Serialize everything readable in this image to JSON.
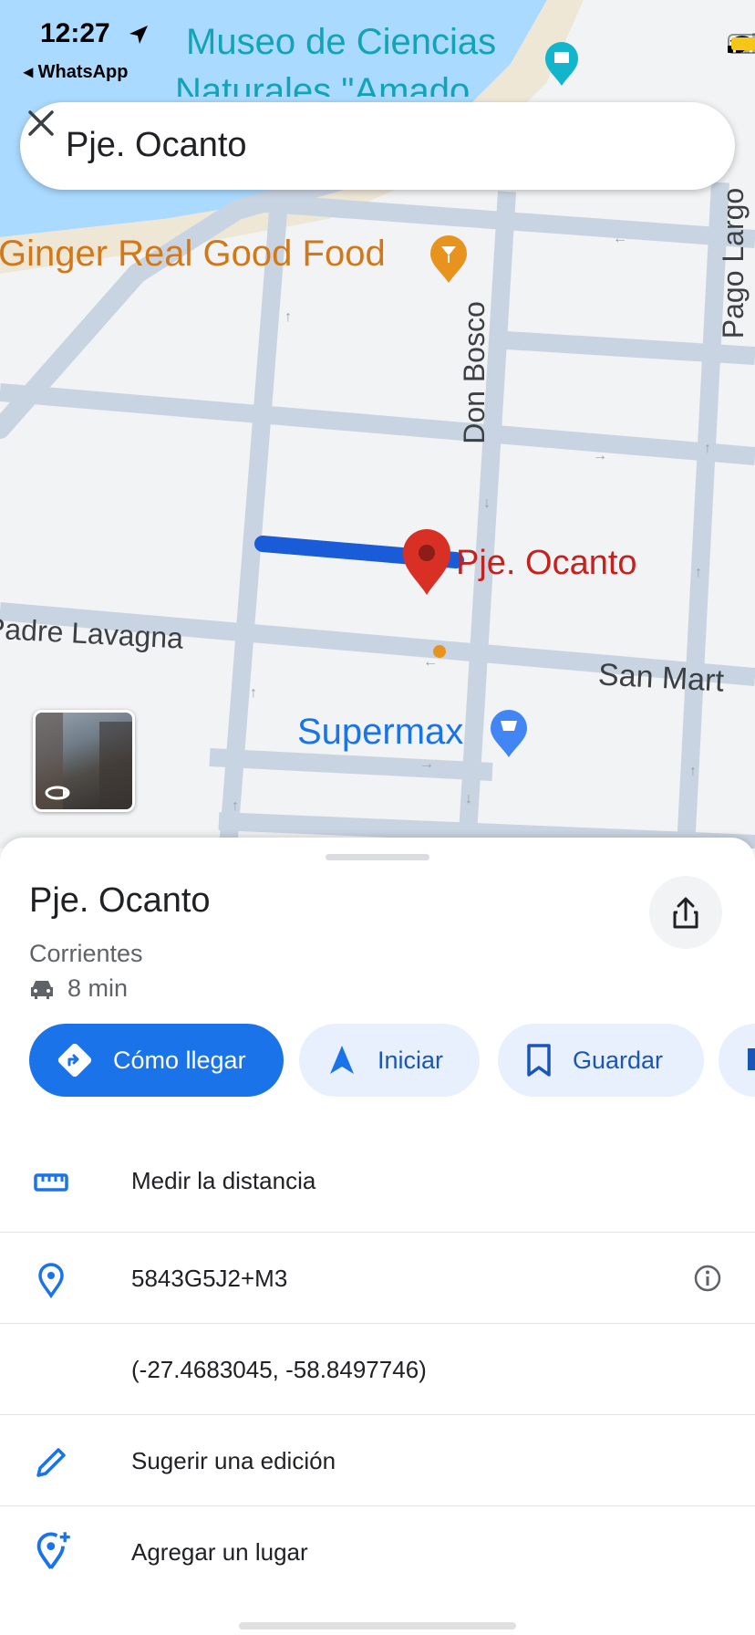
{
  "status_bar": {
    "time": "12:27",
    "back_app": "◂ WhatsApp"
  },
  "search": {
    "query": "Pje. Ocanto"
  },
  "map": {
    "labels": {
      "museum": "Museo de Ciencias",
      "museum_line2": "Naturales \"Amado",
      "restaurant": "Ginger Real Good Food",
      "street_don_bosco": "Don Bosco",
      "street_pago_largo": "Pago Largo",
      "pin_label": "Pje. Ocanto",
      "street_padre_lavagna": "Padre Lavagna",
      "street_san_martin": "San Mart",
      "supermarket": "Supermax"
    },
    "colors": {
      "water": "#aadaff",
      "road": "#c9d4e2",
      "selected_street": "#1a5cd8",
      "pin": "#d93025",
      "poi_food": "#e8931e",
      "poi_museum": "#12b5cb",
      "poi_shop": "#4285f4"
    }
  },
  "place": {
    "name": "Pje. Ocanto",
    "city": "Corrientes",
    "drive_time": "8 min"
  },
  "actions": [
    {
      "label": "Cómo llegar",
      "icon": "directions-icon"
    },
    {
      "label": "Iniciar",
      "icon": "navigation-arrow-icon"
    },
    {
      "label": "Guardar",
      "icon": "bookmark-icon"
    }
  ],
  "rows": [
    {
      "label": "Medir la distancia",
      "icon": "ruler-icon"
    },
    {
      "label": "5843G5J2+M3",
      "icon": "location-pin-icon"
    },
    {
      "label": "(-27.4683045, -58.8497746)",
      "icon": ""
    },
    {
      "label": "Sugerir una edición",
      "icon": "pencil-icon"
    },
    {
      "label": "Agregar un lugar",
      "icon": "add-place-icon"
    }
  ]
}
